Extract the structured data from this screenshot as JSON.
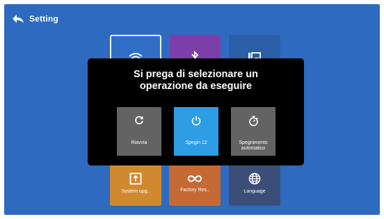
{
  "header": {
    "title": "Setting"
  },
  "tiles": {
    "wifi": {
      "icon": "wifi-icon"
    },
    "bluetooth": {
      "icon": "bluetooth-icon"
    },
    "display": {
      "icon": "display-icon"
    },
    "system": {
      "label": "System upg..",
      "icon": "system-update-icon"
    },
    "factory": {
      "label": "Factory Res..",
      "icon": "factory-reset-icon"
    },
    "language": {
      "label": "Language",
      "icon": "globe-icon"
    }
  },
  "dialog": {
    "title_line1": "Si prega di selezionare un",
    "title_line2": "operazione da eseguire",
    "options": [
      {
        "label": "Riavvia",
        "icon": "restart-icon"
      },
      {
        "label": "Spegin 12",
        "icon": "power-icon",
        "selected": true
      },
      {
        "label": "Spegnimento automatico",
        "icon": "timer-icon"
      }
    ]
  },
  "colors": {
    "background": "#2e6bc0",
    "dialog": "#000000",
    "selected_option": "#2f9ce6",
    "option": "#636363"
  }
}
